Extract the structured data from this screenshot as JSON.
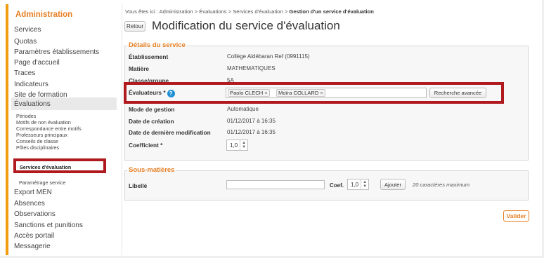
{
  "sidebar": {
    "title": "Administration",
    "items": [
      {
        "label": "Services"
      },
      {
        "label": "Quotas"
      },
      {
        "label": "Paramètres établissements"
      },
      {
        "label": "Page d'accueil"
      },
      {
        "label": "Traces"
      },
      {
        "label": "Indicateurs"
      },
      {
        "label": "Site de formation"
      },
      {
        "label": "Évaluations"
      }
    ],
    "subitems": [
      {
        "label": "Périodes"
      },
      {
        "label": "Motifs de non évaluation"
      },
      {
        "label": "Correspondance entre motifs"
      },
      {
        "label": "Professeurs principaux"
      },
      {
        "label": "Conseils de classe"
      },
      {
        "label": "Pôles disciplinaires"
      },
      {
        "label": "Services d'évaluation"
      },
      {
        "label": "Paramétrage service"
      }
    ],
    "items_after": [
      {
        "label": "Export MEN"
      },
      {
        "label": "Absences"
      },
      {
        "label": "Observations"
      },
      {
        "label": "Sanctions et punitions"
      },
      {
        "label": "Accès portail"
      },
      {
        "label": "Messagerie"
      }
    ]
  },
  "breadcrumb": {
    "prefix": "Vous êtes ici : Administration > Évaluations > Services d'évaluation > ",
    "current": "Gestion d'un service d'évaluation"
  },
  "header": {
    "back_label": "Retour",
    "title": "Modification du service d'évaluation"
  },
  "details": {
    "legend": "Détails du service",
    "etablissement_label": "Établissement",
    "etablissement_value": "Collège Aldébaran Ref (0991115)",
    "matiere_label": "Matière",
    "matiere_value": "MATHEMATIQUES",
    "classe_label": "Classe/groupe",
    "classe_value": "5A",
    "evaluateurs_label": "Évaluateurs *",
    "evaluateurs": [
      "Paolo CLECH",
      "Moïra COLLARD"
    ],
    "search_button": "Recherche avancée",
    "mode_label": "Mode de gestion",
    "mode_value": "Automatique",
    "creation_label": "Date de création",
    "creation_value": "01/12/2017 à 16:35",
    "modif_label": "Date de dernière modification",
    "modif_value": "01/12/2017 à 16:35",
    "coef_label": "Coefficient *",
    "coef_value": "1,0"
  },
  "sous_matieres": {
    "legend": "Sous-matières",
    "libelle_label": "Libellé",
    "libelle_value": "",
    "coef_label": "Coef.",
    "coef_value": "1,0",
    "add_button": "Ajouter",
    "hint": "20 caractères maximum"
  },
  "footer": {
    "submit_label": "Valider"
  },
  "colors": {
    "accent": "#e67e22",
    "highlight_box": "#b0191e",
    "help_icon": "#1f8fd6"
  }
}
